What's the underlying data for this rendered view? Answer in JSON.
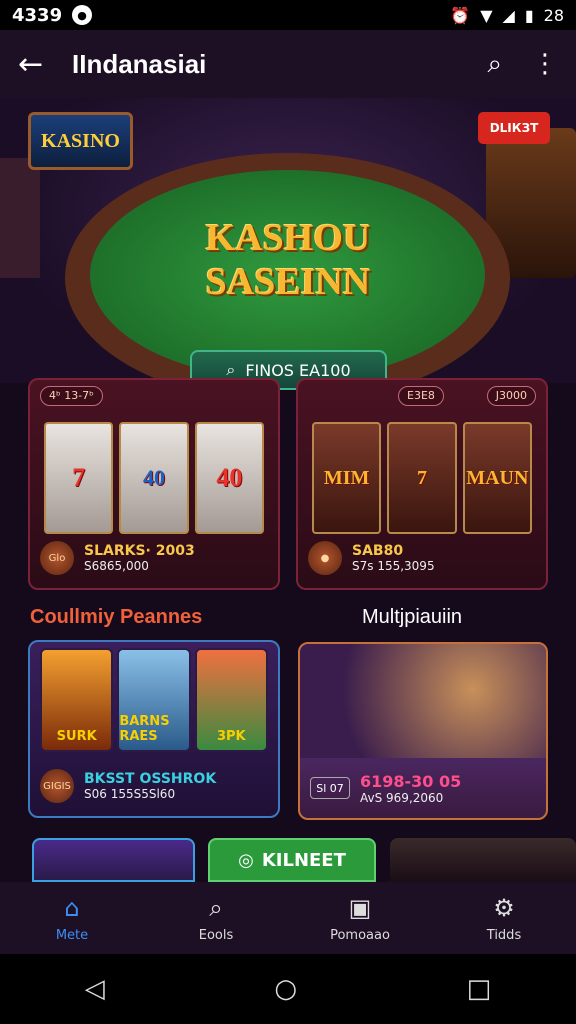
{
  "status_bar": {
    "time": "4339",
    "right_text": "28"
  },
  "app_bar": {
    "title": "IIndanasiai"
  },
  "hero": {
    "sign_left": "KASINO",
    "sign_right": "DLІКЗТ",
    "logo_line1": "KASHOU",
    "logo_line2": "SASEINN",
    "search_button": "FINOS EA100"
  },
  "panel_slots_1": {
    "tag_left": "4ᵇ 13-7ᵇ",
    "reels": [
      "7",
      "40",
      "40"
    ],
    "coin_label": "Glo",
    "title": "SLARKS· 2003",
    "subtitle": "S6865,000"
  },
  "panel_slots_2": {
    "tag_left": "E3E8",
    "tag_right": "J3000",
    "reels": [
      "MIM",
      "7",
      "MAUN"
    ],
    "title": "SAB80",
    "subtitle": "S7s 155,3095"
  },
  "sections": {
    "left": "Coullmiy Peannes",
    "right": "Multjpiauiin"
  },
  "panel_character": {
    "tiles": [
      "SURK",
      "BARNS RAES",
      "3PK"
    ],
    "coin_label": "GIGIS",
    "title": "BKSST OSSHROK",
    "subtitle": "S06 155S5Sl60"
  },
  "panel_multi": {
    "ticket": "Sl 07",
    "title": "6198-30 05",
    "subtitle": "AvS 969,2060"
  },
  "row3_button": "KILNEET",
  "bottom_nav": [
    {
      "label": "Mete",
      "icon": "home-icon"
    },
    {
      "label": "Eools",
      "icon": "search-icon"
    },
    {
      "label": "Pomoaao",
      "icon": "promo-icon"
    },
    {
      "label": "Tidds",
      "icon": "gear-icon"
    }
  ]
}
